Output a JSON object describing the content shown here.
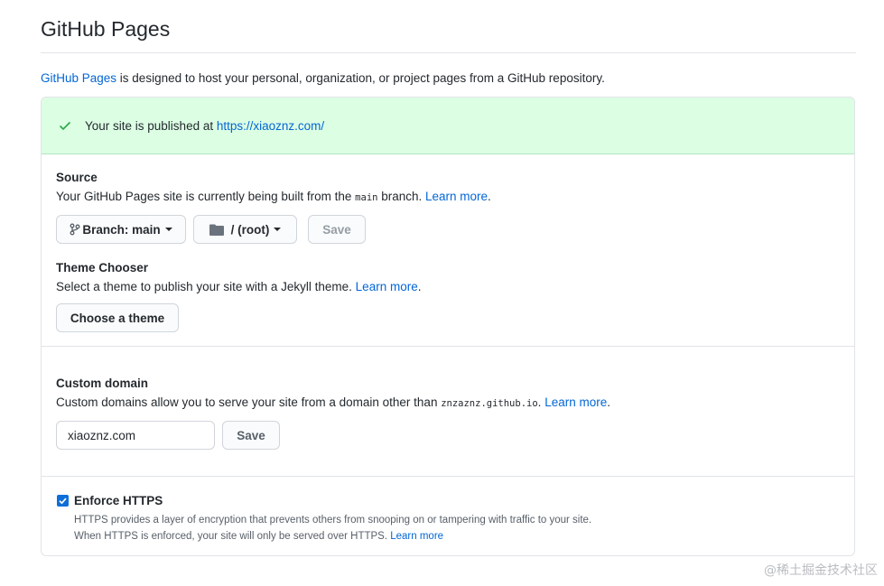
{
  "header": {
    "title": "GitHub Pages"
  },
  "intro": {
    "link": "GitHub Pages",
    "text": " is designed to host your personal, organization, or project pages from a GitHub repository."
  },
  "flash": {
    "text": "Your site is published at ",
    "url": "https://xiaoznz.com/"
  },
  "source": {
    "label": "Source",
    "note_before": "Your GitHub Pages site is currently being built from the ",
    "branch_code": "main",
    "note_after": " branch. ",
    "learn_more": "Learn more",
    "branch_button": "Branch: main",
    "folder_button": "/ (root)",
    "save": "Save"
  },
  "theme": {
    "label": "Theme Chooser",
    "note": "Select a theme to publish your site with a Jekyll theme. ",
    "learn_more": "Learn more",
    "button": "Choose a theme"
  },
  "domain": {
    "label": "Custom domain",
    "note_before": "Custom domains allow you to serve your site from a domain other than ",
    "default_domain": "znzaznz.github.io",
    "note_after": ". ",
    "learn_more": "Learn more",
    "value": "xiaoznz.com",
    "save": "Save"
  },
  "https": {
    "label": "Enforce HTTPS",
    "checked": true,
    "line1": "HTTPS provides a layer of encryption that prevents others from snooping on or tampering with traffic to your site.",
    "line2": "When HTTPS is enforced, your site will only be served over HTTPS. ",
    "learn_more": "Learn more"
  },
  "watermark": "@稀土掘金技术社区",
  "colors": {
    "link": "#0366d6",
    "flash_bg": "#dcffe4",
    "check": "#28a745",
    "checkbox": "#0f6fd8"
  }
}
